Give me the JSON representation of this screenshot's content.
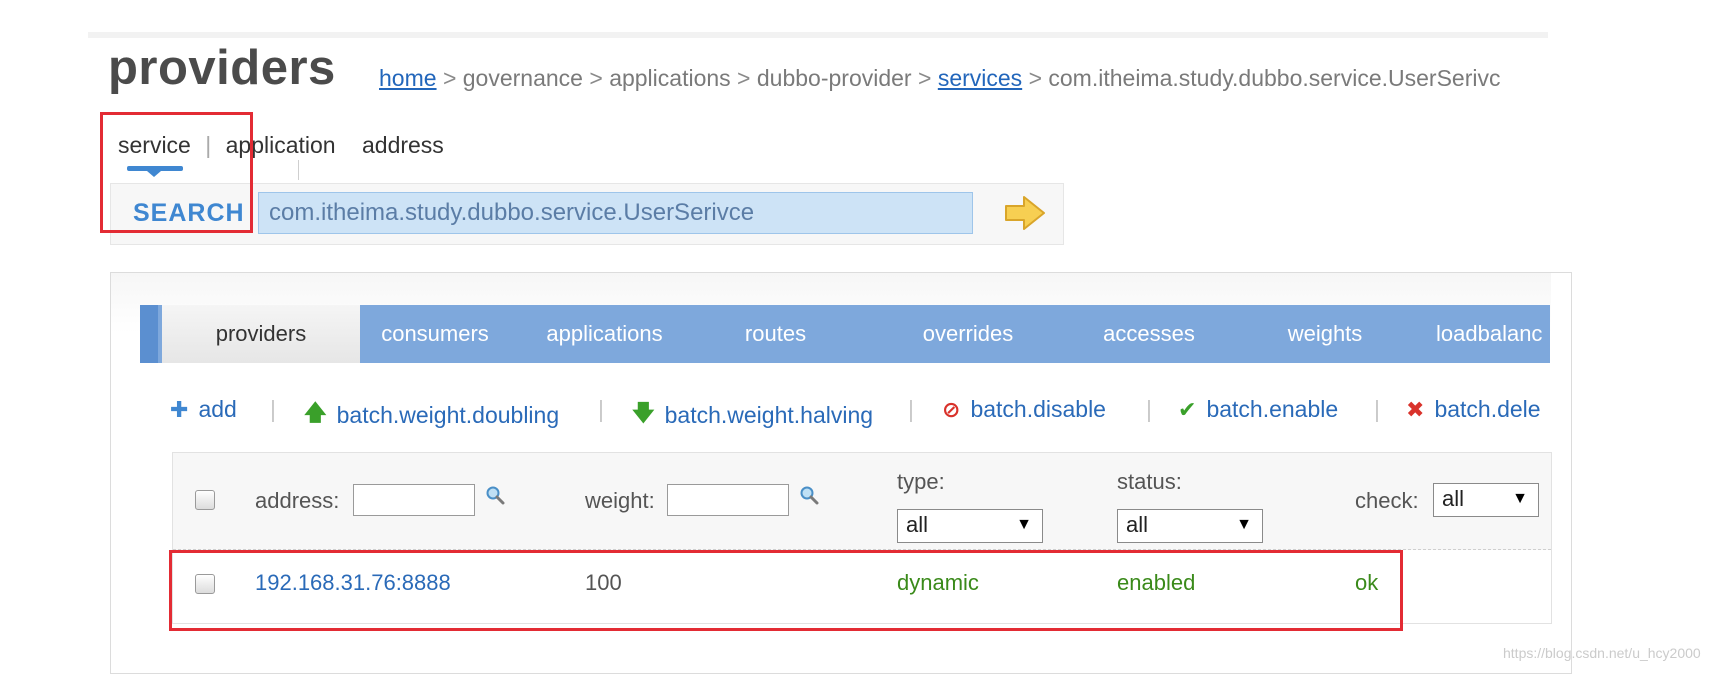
{
  "page": {
    "title": "providers",
    "breadcrumb": {
      "home": "home",
      "governance": "governance",
      "applications": "applications",
      "provider": "dubbo-provider",
      "services": "services",
      "service_name": "com.itheima.study.dubbo.service.UserSerivc",
      "separator": ">"
    }
  },
  "search": {
    "tabs": [
      "service",
      "application",
      "address"
    ],
    "label": "SEARCH",
    "value": "com.itheima.study.dubbo.service.UserSerivce"
  },
  "tabs": [
    "providers",
    "consumers",
    "applications",
    "routes",
    "overrides",
    "accesses",
    "weights",
    "loadbalanc"
  ],
  "toolbar": {
    "add": "add",
    "weight_doubling": "batch.weight.doubling",
    "weight_halving": "batch.weight.halving",
    "disable": "batch.disable",
    "enable": "batch.enable",
    "delete": "batch.dele",
    "separator": "|"
  },
  "table": {
    "filters": {
      "address_label": "address:",
      "weight_label": "weight:",
      "type_label": "type:",
      "type_value": "all",
      "status_label": "status:",
      "status_value": "all",
      "check_label": "check:",
      "check_value": "all"
    },
    "rows": [
      {
        "address": "192.168.31.76:8888",
        "weight": "100",
        "type": "dynamic",
        "status": "enabled",
        "check": "ok"
      }
    ]
  },
  "watermark": "https://blog.csdn.net/u_hcy2000",
  "colors": {
    "accent": "#3f87d1",
    "tab_strip": "#7ea8dc",
    "link": "#2a6ab8",
    "green_text": "#3a8a1a",
    "highlight": "#e32b34"
  }
}
